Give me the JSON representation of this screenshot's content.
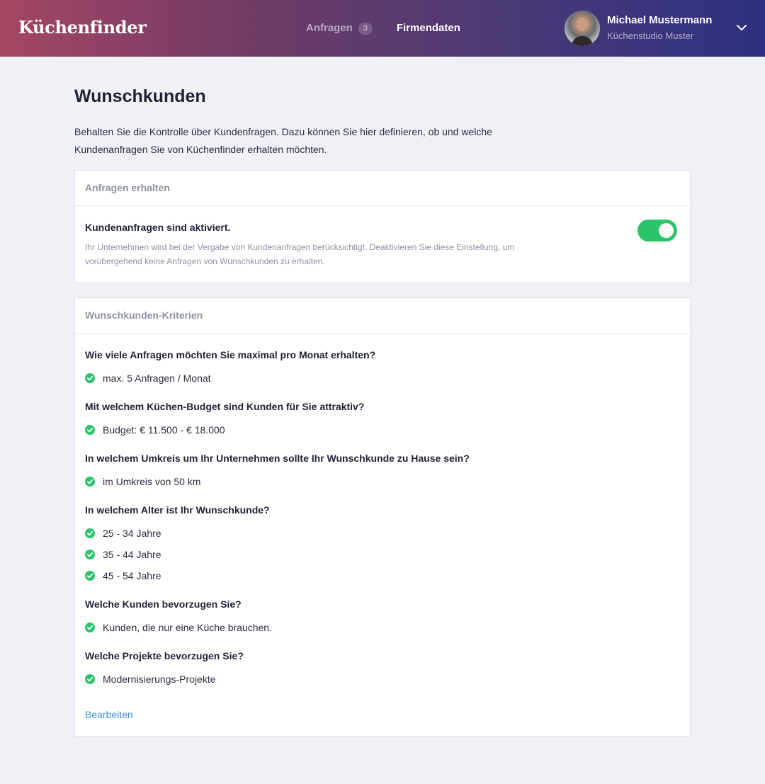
{
  "header": {
    "logo": "Küchenfinder",
    "nav": [
      {
        "label": "Anfragen",
        "badge": "3"
      },
      {
        "label": "Firmendaten"
      }
    ],
    "user": {
      "name": "Michael Mustermann",
      "company": "Küchenstudio Muster"
    },
    "icons": {
      "menu": "chevron-down-icon",
      "check": "check-circle-icon"
    }
  },
  "page": {
    "title": "Wunschkunden",
    "intro": "Behalten Sie die Kontrolle über Kundenfragen. Dazu können Sie hier definieren, ob und welche Kundenanfragen Sie von Küchenfinder erhalten möchten."
  },
  "anfragen_card": {
    "header": "Anfragen erhalten",
    "toggle_title": "Kundenanfragen sind aktiviert.",
    "toggle_desc": "Ihr Unternehmen wird bei der Vergabe von Kundenanfragen berücksichtigt. Deaktivieren Sie diese Einstellung, um vorübergehend keine Anfragen von Wunschkunden zu erhalten.",
    "toggle_on": true
  },
  "kriterien_card": {
    "header": "Wunschkunden-Kriterien",
    "questions": [
      {
        "question": "Wie viele Anfragen möchten Sie maximal pro Monat erhalten?",
        "answers": [
          "max. 5 Anfragen / Monat"
        ]
      },
      {
        "question": "Mit welchem Küchen-Budget sind Kunden für Sie attraktiv?",
        "answers": [
          "Budget: € 11.500 - € 18.000"
        ]
      },
      {
        "question": "In welchem Umkreis um Ihr Unternehmen sollte Ihr Wunschkunde zu Hause sein?",
        "answers": [
          "im Umkreis von 50 km"
        ]
      },
      {
        "question": "In welchem Alter ist Ihr Wunschkunde?",
        "answers": [
          "25 - 34 Jahre",
          "35 - 44 Jahre",
          "45 - 54 Jahre"
        ]
      },
      {
        "question": "Welche Kunden bevorzugen Sie?",
        "answers": [
          "Kunden, die nur eine Küche brauchen."
        ]
      },
      {
        "question": "Welche Projekte bevorzugen Sie?",
        "answers": [
          "Modernisierungs-Projekte"
        ]
      }
    ],
    "edit_label": "Bearbeiten"
  },
  "colors": {
    "accent_green": "#2bc46a",
    "link_blue": "#3d8fe0",
    "header_gradient_start": "#a54662",
    "header_gradient_end": "#2e2f82"
  }
}
